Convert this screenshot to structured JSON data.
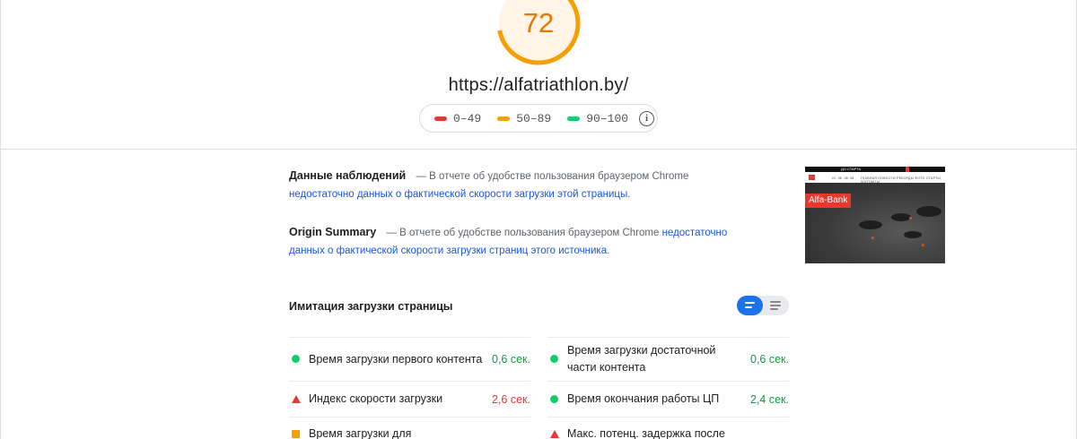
{
  "score": {
    "value": "72",
    "fraction": 0.72,
    "color": "#f59f00"
  },
  "url": "https://alfatriathlon.by/",
  "legend": {
    "items": [
      {
        "label": "0–49",
        "color": "#e53935"
      },
      {
        "label": "50–89",
        "color": "#f59f00"
      },
      {
        "label": "90–100",
        "color": "#0cce6b"
      }
    ],
    "info_icon": "info-icon"
  },
  "field_data": {
    "title": "Данные наблюдений",
    "text": "— В отчете об удобстве пользования браузером Chrome",
    "link": "недостаточно данных о фактической скорости загрузки этой страницы",
    "suffix": "."
  },
  "origin_summary": {
    "title": "Origin Summary",
    "text": "— В отчете об удобстве пользования браузером Chrome",
    "link": "недостаточно данных о фактической скорости загрузки страниц этого источника",
    "suffix": "."
  },
  "screenshot": {
    "badge": "Alfa-Bank",
    "top_text": "ДО СТАРТА",
    "nav_line": "21 : 06 : 08 : 55",
    "nav_menu": "ГЛАВНАЯ  НОВОСТИ  РЕКОРДЫ  ФОТО  СТАРТЫ  КОНТАКТЫ"
  },
  "lab_data": {
    "title": "Имитация загрузки страницы",
    "toggle_icons": [
      "compact-view-icon",
      "list-view-icon"
    ],
    "metrics_left": [
      {
        "label": "Время загрузки первого контента",
        "value": "0,6 сек.",
        "status": "good"
      },
      {
        "label": "Индекс скорости загрузки",
        "value": "2,6 сек.",
        "status": "bad"
      },
      {
        "label": "Время загрузки для",
        "value": "",
        "status": "average"
      }
    ],
    "metrics_right": [
      {
        "label": "Время загрузки достаточной части контента",
        "value": "0,6 сек.",
        "status": "good"
      },
      {
        "label": "Время окончания работы ЦП",
        "value": "2,4 сек.",
        "status": "good"
      },
      {
        "label": "Макс. потенц. задержка после",
        "value": "",
        "status": "bad"
      }
    ]
  }
}
